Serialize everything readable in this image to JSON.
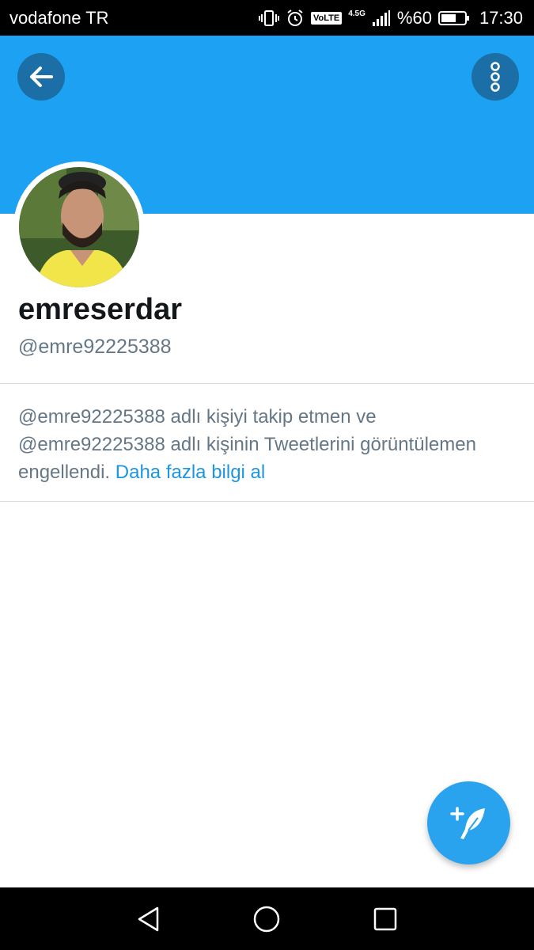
{
  "status_bar": {
    "carrier": "vodafone TR",
    "volte": "VoLTE",
    "network": "4.5G",
    "battery_percent": "%60",
    "time": "17:30",
    "icons": [
      "vibrate-icon",
      "alarm-icon",
      "volte-icon",
      "signal-icon",
      "battery-icon"
    ]
  },
  "header": {
    "color": "#1da1f2",
    "back_icon": "arrow-left-icon",
    "more_icon": "more-vertical-icon"
  },
  "profile": {
    "display_name": "emreserdar",
    "handle": "@emre92225388"
  },
  "blocked_notice": {
    "text": "@emre92225388 adlı kişiyi takip etmen ve @emre92225388 adlı kişinin Tweetlerini görüntülemen engellendi.",
    "link_label": "Daha fazla bilgi al"
  },
  "fab": {
    "icon": "compose-tweet-icon",
    "color": "#2aa3ef"
  },
  "nav_bar": {
    "icons": [
      "nav-back-icon",
      "nav-home-icon",
      "nav-recent-icon"
    ]
  }
}
